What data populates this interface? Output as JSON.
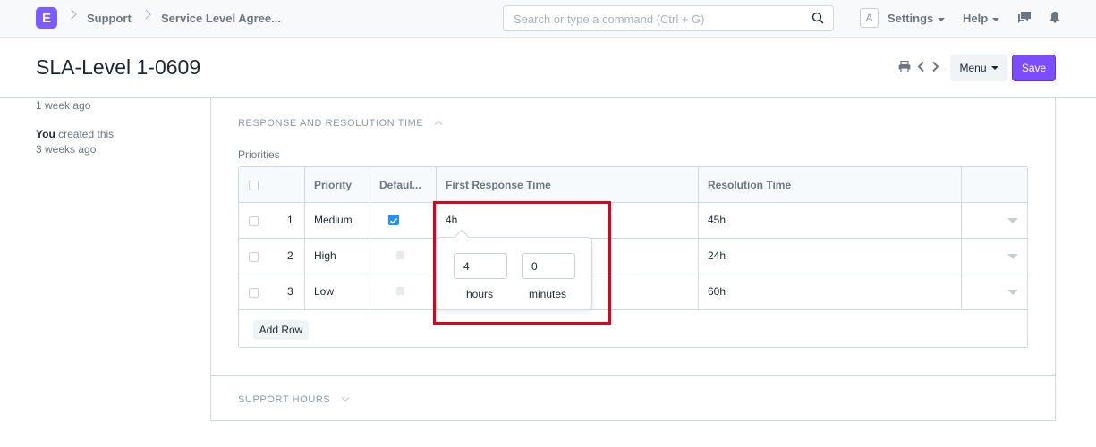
{
  "navbar": {
    "logo_letter": "E",
    "breadcrumbs": [
      "Support",
      "Service Level Agree..."
    ],
    "search_placeholder": "Search or type a command (Ctrl + G)",
    "avatar_letter": "A",
    "settings_label": "Settings",
    "help_label": "Help"
  },
  "page": {
    "title": "SLA-Level 1-0609",
    "menu_label": "Menu",
    "save_label": "Save"
  },
  "timeline": {
    "modified": "1 week ago",
    "created_by": "You",
    "created_text": "created this",
    "created_time": "3 weeks ago"
  },
  "section": {
    "response_title": "RESPONSE AND RESOLUTION TIME",
    "priorities_label": "Priorities",
    "support_hours_title": "SUPPORT HOURS",
    "add_row_label": "Add Row"
  },
  "grid": {
    "columns": [
      "Priority",
      "Defaul...",
      "First Response Time",
      "Resolution Time"
    ],
    "rows": [
      {
        "idx": "1",
        "priority": "Medium",
        "default": true,
        "first_response": "4h",
        "resolution": "45h"
      },
      {
        "idx": "2",
        "priority": "High",
        "default": false,
        "first_response": "",
        "resolution": "24h"
      },
      {
        "idx": "3",
        "priority": "Low",
        "default": false,
        "first_response": "",
        "resolution": "60h"
      }
    ]
  },
  "duration_picker": {
    "hours_value": "4",
    "minutes_value": "0",
    "hours_label": "hours",
    "minutes_label": "minutes"
  },
  "colors": {
    "brand": "#7c5cff",
    "save": "#7c4dff",
    "checkbox_on": "#2490ef",
    "highlight": "#e0001b"
  }
}
